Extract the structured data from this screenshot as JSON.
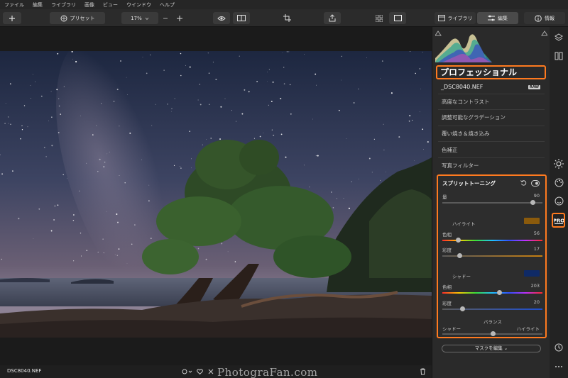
{
  "menu": [
    "ファイル",
    "編集",
    "ライブラリ",
    "画像",
    "ビュー",
    "ウインドウ",
    "ヘルプ"
  ],
  "toolbar": {
    "presets_label": "プリセット",
    "zoom_value": "17%",
    "library_tab": "ライブラリ",
    "edit_tab": "編集",
    "info_tab": "情報"
  },
  "panel": {
    "section_title": "プロフェッショナル",
    "file_name": "_DSC8040.NEF",
    "raw_badge": "RAW",
    "tools": [
      "高度なコントラスト",
      "調整可能なグラデーション",
      "覆い焼き＆焼き込み",
      "色補正",
      "写真フィルター"
    ],
    "split_toning": {
      "title": "スプリットトーニング",
      "amount": {
        "label": "量",
        "value": 90
      },
      "highlights": {
        "label": "ハイライト",
        "color": "#8a5a0c",
        "hue": {
          "label": "色相",
          "value": 56
        },
        "saturation": {
          "label": "彩度",
          "value": 17
        }
      },
      "shadows": {
        "label": "シャドー",
        "color": "#0f2a66",
        "hue": {
          "label": "色相",
          "value": 203
        },
        "saturation": {
          "label": "彩度",
          "value": 20
        }
      },
      "balance": {
        "label": "バランス",
        "left_label": "シャドー",
        "right_label": "ハイライト",
        "value": 0.5
      }
    },
    "mask_button": "マスクを編集"
  },
  "bottom": {
    "file_name": "DSC8040.NEF",
    "watermark": "PhotograFan.com"
  },
  "colors": {
    "accent": "#ff7a1f"
  }
}
